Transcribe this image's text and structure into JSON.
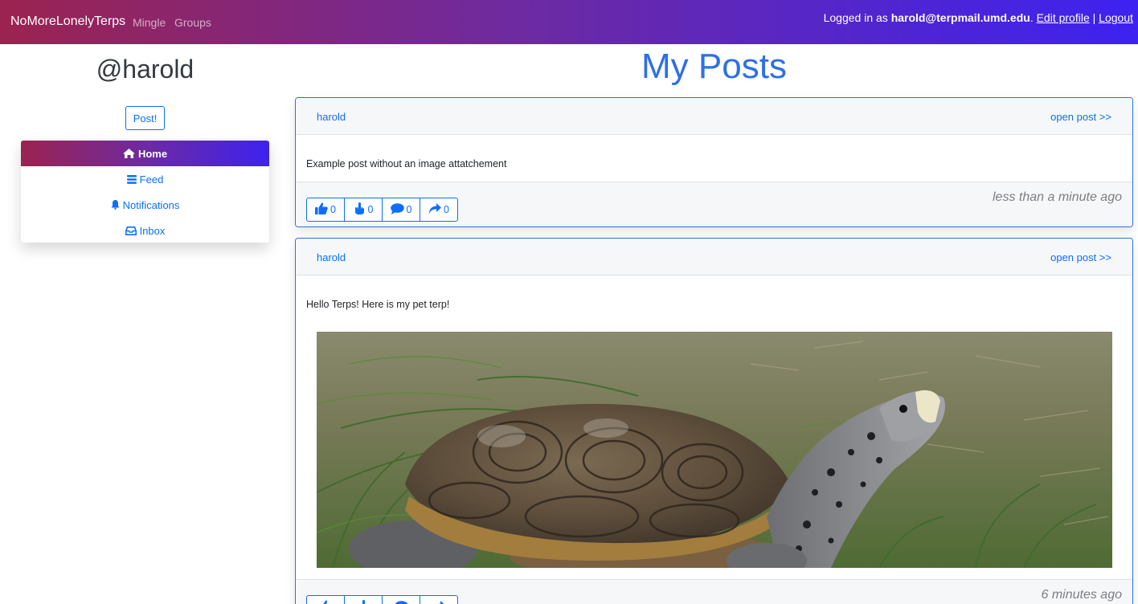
{
  "navbar": {
    "brand": "NoMoreLonelyTerps",
    "links": [
      "Mingle",
      "Groups"
    ],
    "logged_in_prefix": "Logged in as ",
    "user_email": "harold@terpmail.umd.edu",
    "after_email": ". ",
    "edit_profile": "Edit profile",
    "separator": " | ",
    "logout": "Logout"
  },
  "sidebar": {
    "handle": "@harold",
    "post_button": "Post!",
    "menu": [
      {
        "label": "Home",
        "icon": "home-icon"
      },
      {
        "label": "Feed",
        "icon": "list-icon"
      },
      {
        "label": "Notifications",
        "icon": "bell-icon"
      },
      {
        "label": "Inbox",
        "icon": "inbox-icon"
      }
    ]
  },
  "main": {
    "title": "My Posts",
    "posts": [
      {
        "author": "harold",
        "open_link": "open post >>",
        "text": "Example post without an image attatchement",
        "time": "less than a minute ago",
        "counts": {
          "likes": "0",
          "thumbs": "0",
          "comments": "0",
          "shares": "0"
        }
      },
      {
        "author": "harold",
        "open_link": "open post >>",
        "text": "Hello Terps! Here is my pet terp!",
        "time": "6 minutes ago",
        "image": "turtle-photo"
      }
    ]
  },
  "colors": {
    "accent": "#0d6efd",
    "title": "#2e6fe6",
    "gradient_start": "#9b2350",
    "gradient_end": "#3d22f0"
  }
}
